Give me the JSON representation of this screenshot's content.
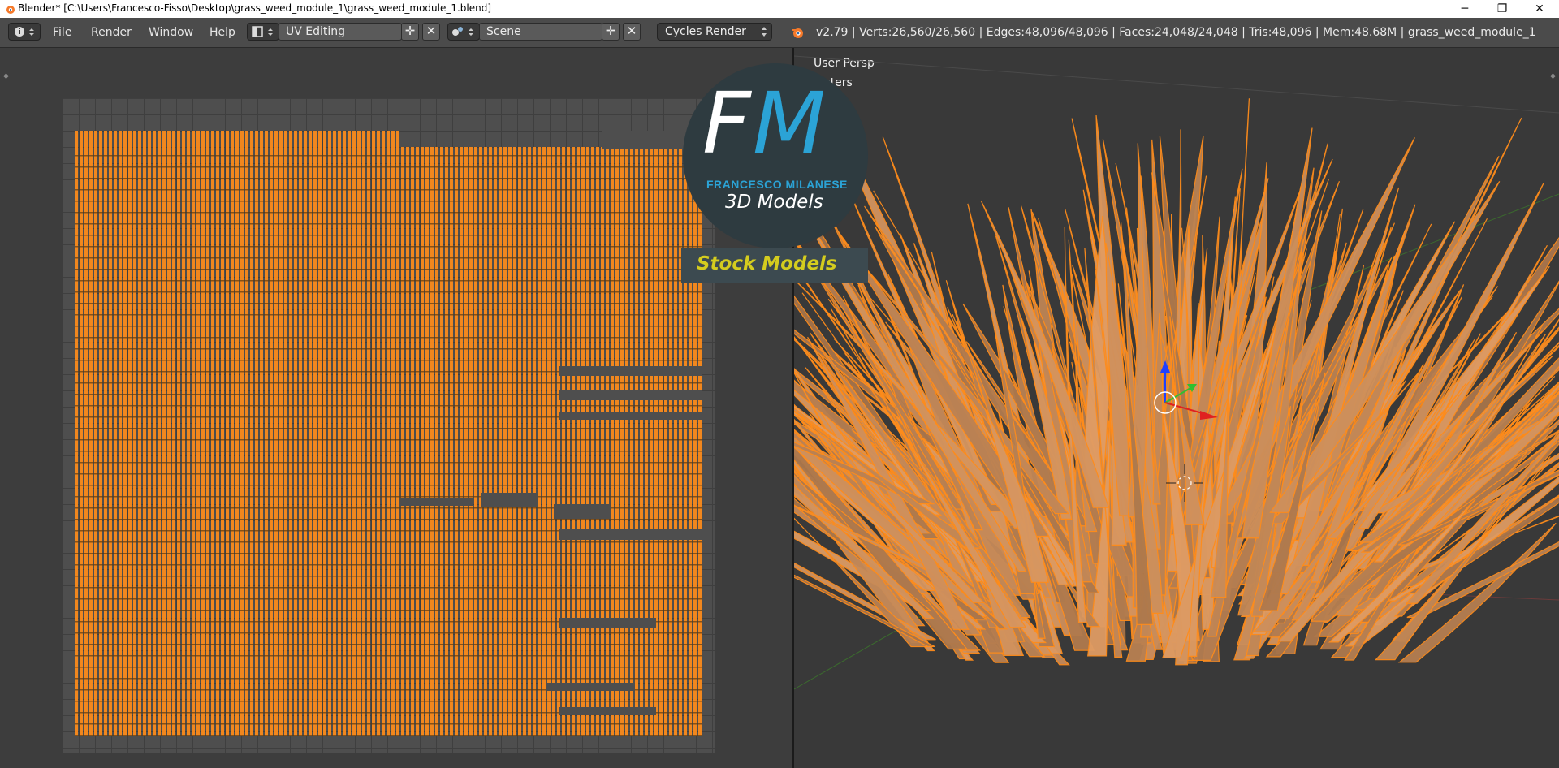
{
  "window": {
    "title": "Blender* [C:\\Users\\Francesco-Fisso\\Desktop\\grass_weed_module_1\\grass_weed_module_1.blend]",
    "controls": [
      "─",
      "❐",
      "✕"
    ]
  },
  "menu": [
    "File",
    "Render",
    "Window",
    "Help"
  ],
  "screen_layout": {
    "value": "UV Editing"
  },
  "scene": {
    "value": "Scene"
  },
  "render_engine": {
    "value": "Cycles Render"
  },
  "stats": "v2.79 | Verts:26,560/26,560 | Edges:48,096/48,096 | Faces:24,048/24,048 | Tris:48,096 | Mem:48.68M | grass_weed_module_1",
  "viewport": {
    "view_name": "User Persp",
    "object_label": "Meters"
  },
  "watermark": {
    "initials_f": "F",
    "initials_m": "M",
    "name": "FRANCESCO MILANESE",
    "tagline": "3D Models",
    "banner": "Stock Models"
  },
  "colors": {
    "accent_orange": "#ff8c1a",
    "logo_blue": "#2ba3d6",
    "logo_banner_text": "#d4cc1e"
  }
}
